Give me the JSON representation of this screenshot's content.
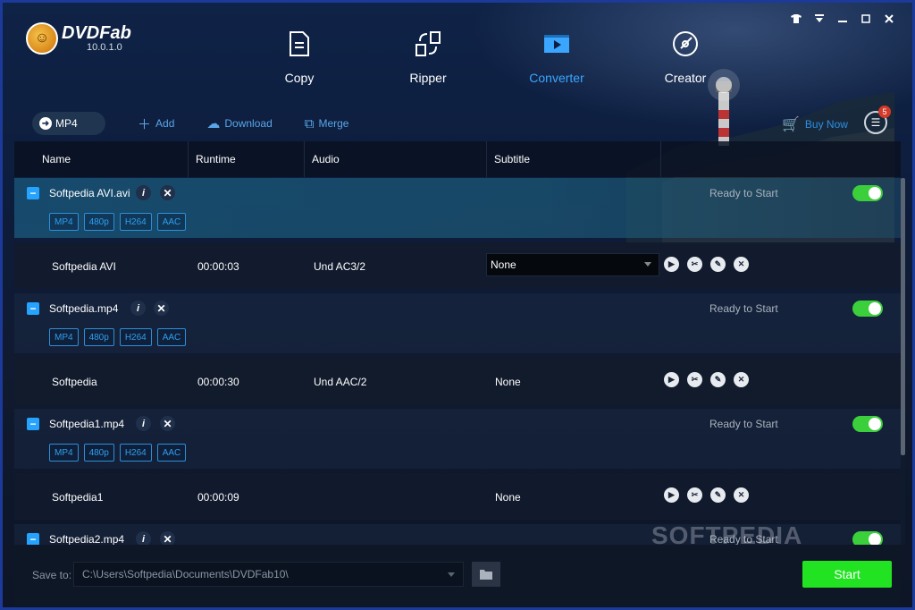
{
  "app": {
    "name": "DVDFab",
    "version": "10.0.1.0",
    "logo_icon": "monkey-logo",
    "accent": "#26a3ff",
    "start_color": "#22e322"
  },
  "nav": [
    {
      "label": "Copy",
      "icon": "copy-icon"
    },
    {
      "label": "Ripper",
      "icon": "ripper-icon"
    },
    {
      "label": "Converter",
      "icon": "converter-icon",
      "active": true
    },
    {
      "label": "Creator",
      "icon": "creator-icon"
    }
  ],
  "window_controls": [
    "skin-icon",
    "menu-icon",
    "minimize-icon",
    "maximize-icon",
    "close-icon"
  ],
  "toolbar": {
    "profile": "MP4",
    "add": "Add",
    "download": "Download",
    "merge": "Merge",
    "buy_now": "Buy Now",
    "task_count": "5"
  },
  "columns": {
    "name": "Name",
    "runtime": "Runtime",
    "audio": "Audio",
    "subtitle": "Subtitle"
  },
  "files": [
    {
      "file": "Softpedia AVI.avi",
      "tags": [
        "MP4",
        "480p",
        "H264",
        "AAC"
      ],
      "status": "Ready to Start",
      "enabled": true,
      "track": {
        "title": "Softpedia AVI",
        "runtime": "00:00:03",
        "audio": "Und  AC3/2",
        "subtitle": "None"
      }
    },
    {
      "file": "Softpedia.mp4",
      "tags": [
        "MP4",
        "480p",
        "H264",
        "AAC"
      ],
      "status": "Ready to Start",
      "enabled": true,
      "track": {
        "title": "Softpedia",
        "runtime": "00:00:30",
        "audio": "Und  AAC/2",
        "subtitle": "None"
      }
    },
    {
      "file": "Softpedia1.mp4",
      "tags": [
        "MP4",
        "480p",
        "H264",
        "AAC"
      ],
      "status": "Ready to Start",
      "enabled": true,
      "track": {
        "title": "Softpedia1",
        "runtime": "00:00:09",
        "audio": "",
        "subtitle": "None"
      }
    },
    {
      "file": "Softpedia2.mp4",
      "status": "Ready to Start",
      "enabled": true
    }
  ],
  "footer": {
    "save_to_label": "Save to:",
    "save_path": "C:\\Users\\Softpedia\\Documents\\DVDFab10\\",
    "start": "Start"
  },
  "watermark": "SOFTPEDIA"
}
